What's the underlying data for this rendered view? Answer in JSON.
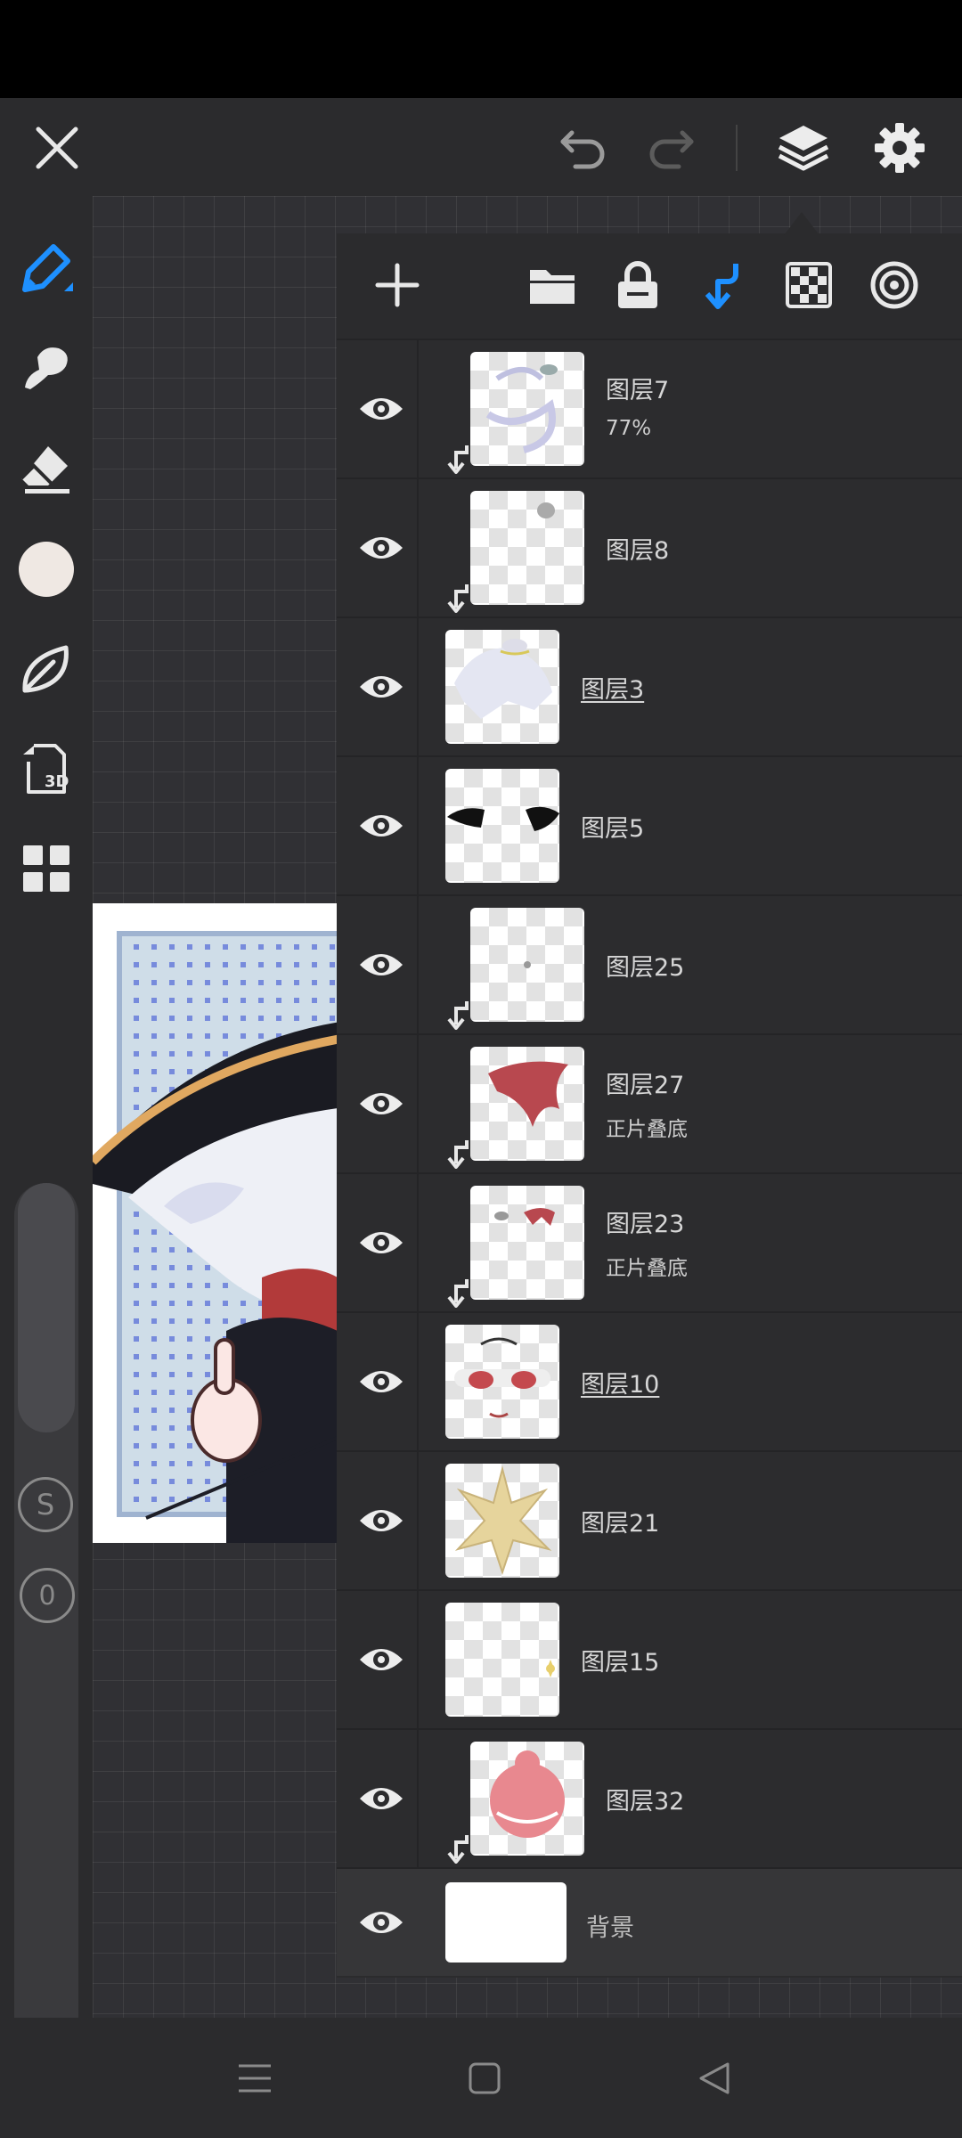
{
  "colors": {
    "accent": "#1e90ff",
    "panel": "#2b2b2d",
    "text": "#d6d6d6"
  },
  "topbar": {
    "close_icon": "close-icon",
    "undo_icon": "undo-icon",
    "redo_icon": "redo-icon",
    "layers_icon": "layers-icon",
    "settings_icon": "gear-icon"
  },
  "tools": [
    "pen-icon",
    "smudge-icon",
    "eraser-icon",
    "color-swatch",
    "leaf-icon",
    "3d-icon",
    "grid-icon"
  ],
  "tool_3d_label": "3D",
  "sliders": {
    "size_label": "S",
    "opacity_label": "0"
  },
  "panel_tools": [
    "add-layer-icon",
    "folder-icon",
    "lock-icon",
    "clip-icon",
    "transparency-icon",
    "target-icon"
  ],
  "layers": [
    {
      "name": "图层7",
      "sub": "77%",
      "clipped": true,
      "underline": false
    },
    {
      "name": "图层8",
      "sub": "",
      "clipped": true,
      "underline": false
    },
    {
      "name": "图层3",
      "sub": "",
      "clipped": false,
      "underline": true
    },
    {
      "name": "图层5",
      "sub": "",
      "clipped": false,
      "underline": false
    },
    {
      "name": "图层25",
      "sub": "",
      "clipped": true,
      "underline": false
    },
    {
      "name": "图层27",
      "sub": "正片叠底",
      "clipped": true,
      "underline": false
    },
    {
      "name": "图层23",
      "sub": "正片叠底",
      "clipped": true,
      "underline": false
    },
    {
      "name": "图层10",
      "sub": "",
      "clipped": false,
      "underline": true
    },
    {
      "name": "图层21",
      "sub": "",
      "clipped": false,
      "underline": false
    },
    {
      "name": "图层15",
      "sub": "",
      "clipped": false,
      "underline": false
    },
    {
      "name": "图层32",
      "sub": "",
      "clipped": true,
      "underline": false
    }
  ],
  "background_layer": {
    "name": "背景"
  },
  "navbar": [
    "menu-icon",
    "home-icon",
    "back-icon"
  ]
}
